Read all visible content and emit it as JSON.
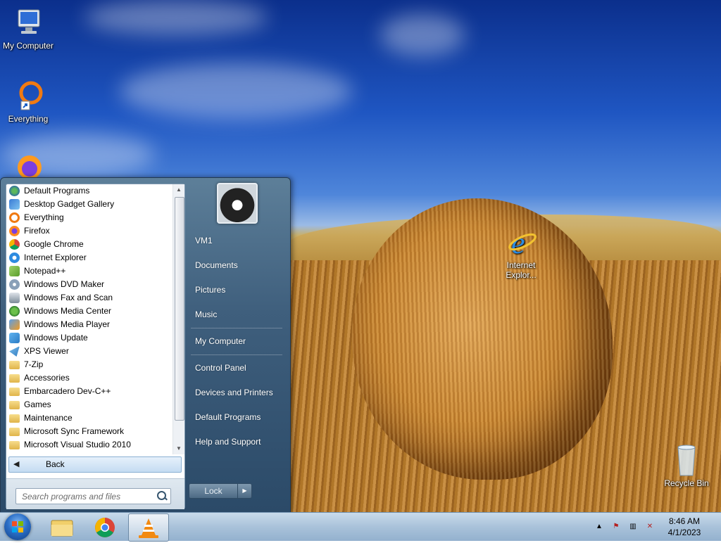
{
  "desktop": {
    "icons": [
      {
        "label": "My Computer"
      },
      {
        "label": "Everything"
      },
      {
        "label": "Internet Explor..."
      },
      {
        "label": "Recycle Bin"
      }
    ]
  },
  "start_menu": {
    "programs": [
      {
        "label": "Default Programs",
        "icon": "default-programs-icon"
      },
      {
        "label": "Desktop Gadget Gallery",
        "icon": "gadget-gallery-icon"
      },
      {
        "label": "Everything",
        "icon": "everything-icon"
      },
      {
        "label": "Firefox",
        "icon": "firefox-icon"
      },
      {
        "label": "Google Chrome",
        "icon": "chrome-icon"
      },
      {
        "label": "Internet Explorer",
        "icon": "internet-explorer-icon"
      },
      {
        "label": "Notepad++",
        "icon": "notepad-plus-plus-icon"
      },
      {
        "label": "Windows DVD Maker",
        "icon": "dvd-maker-icon"
      },
      {
        "label": "Windows Fax and Scan",
        "icon": "fax-scan-icon"
      },
      {
        "label": "Windows Media Center",
        "icon": "media-center-icon"
      },
      {
        "label": "Windows Media Player",
        "icon": "media-player-icon"
      },
      {
        "label": "Windows Update",
        "icon": "windows-update-icon"
      },
      {
        "label": "XPS Viewer",
        "icon": "xps-viewer-icon"
      },
      {
        "label": "7-Zip",
        "icon": "folder-icon"
      },
      {
        "label": "Accessories",
        "icon": "folder-icon"
      },
      {
        "label": "Embarcadero Dev-C++",
        "icon": "folder-icon"
      },
      {
        "label": "Games",
        "icon": "folder-icon"
      },
      {
        "label": "Maintenance",
        "icon": "folder-icon"
      },
      {
        "label": "Microsoft Sync Framework",
        "icon": "folder-icon"
      },
      {
        "label": "Microsoft Visual Studio 2010",
        "icon": "folder-icon"
      }
    ],
    "back_label": "Back",
    "search_placeholder": "Search programs and files",
    "right_items": [
      {
        "label": "VM1"
      },
      {
        "label": "Documents"
      },
      {
        "label": "Pictures"
      },
      {
        "label": "Music"
      },
      {
        "label": "My Computer"
      },
      {
        "label": "Control Panel"
      },
      {
        "label": "Devices and Printers"
      },
      {
        "label": "Default Programs"
      },
      {
        "label": "Help and Support"
      }
    ],
    "lock_label": "Lock"
  },
  "taskbar": {
    "pinned": [
      "windows-explorer-icon",
      "chrome-icon",
      "vlc-icon"
    ],
    "clock_time": "8:46 AM",
    "clock_date": "4/1/2023",
    "tray_icons": [
      "show-hidden-icons-icon",
      "action-center-flag-icon",
      "network-icon",
      "volume-muted-icon"
    ]
  },
  "colors": {
    "start_menu_bg": "#3f5f7d",
    "taskbar_bg": "#a9c2da",
    "accent": "#2b6fc7"
  }
}
